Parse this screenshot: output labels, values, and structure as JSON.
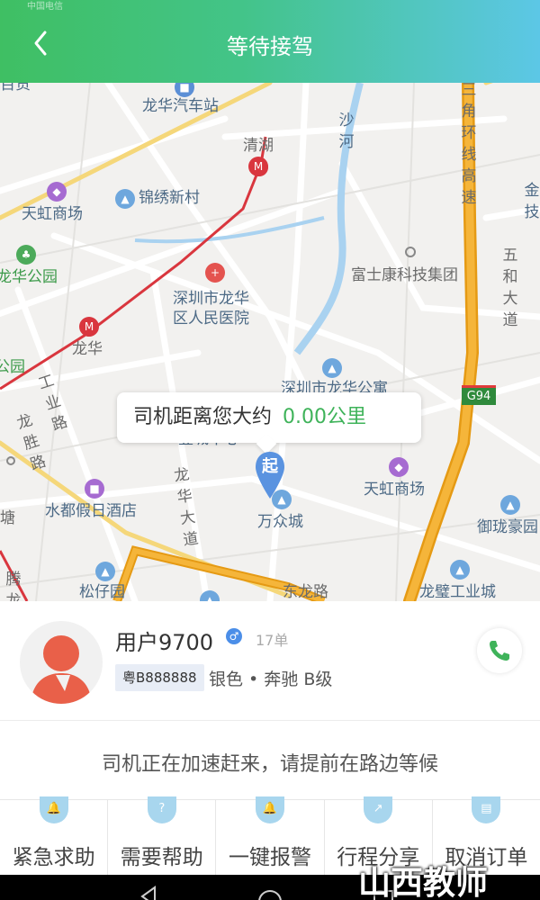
{
  "header": {
    "status_text": "中国电信",
    "title": "等待接驾"
  },
  "map": {
    "pois": {
      "baihuo": "百货",
      "longhua_bus": "龙华汽车站",
      "qinghu": "清湖",
      "jinxiu": "锦绣新村",
      "tianhong_1": "天虹商场",
      "longhua_park": "龙华公园",
      "hospital_1": "深圳市龙华",
      "hospital_2": "区人民医院",
      "longhua": "龙华",
      "gongyuan": "公园",
      "gongye_road": "工业路",
      "longsheng_road": "龙胜路",
      "foxconn": "富士康科技集团",
      "shahe": "沙河",
      "sanjiao_highway": "三角环线高速",
      "wuhe_road": "五和大道",
      "jinji": "金技",
      "apartment": "深圳市龙华公寓",
      "dengcheng": "壹城中心",
      "tianhong_2": "天虹商场",
      "shuidu": "水都假日酒店",
      "longhua_avenue": "龙华大道",
      "wanzhong": "万众城",
      "yulong": "御珑豪园",
      "tang": "塘",
      "tengbu": "腾龙",
      "songzai": "松仔园",
      "dongbu_road": "东龙路",
      "longbi": "龙璧工业城",
      "g94": "G94"
    },
    "bubble_label": "司机距离您大约",
    "bubble_value": "0.00公里",
    "pin_label": "起"
  },
  "driver": {
    "name": "用户9700",
    "gender_symbol": "♂",
    "orders": "17单",
    "plate": "粤B888888",
    "car": "银色 • 奔驰 B级"
  },
  "notice": "司机正在加速赶来，请提前在路边等候",
  "actions": [
    {
      "label": "紧急求助",
      "icon": "bell-icon",
      "glyph": "🔔"
    },
    {
      "label": "需要帮助",
      "icon": "question-icon",
      "glyph": "?"
    },
    {
      "label": "一键报警",
      "icon": "alarm-icon",
      "glyph": "🔔"
    },
    {
      "label": "行程分享",
      "icon": "share-icon",
      "glyph": "↗"
    },
    {
      "label": "取消订单",
      "icon": "cancel-order-icon",
      "glyph": "▤"
    }
  ],
  "watermark": "山西教师",
  "colors": {
    "header_gradient_start": "#3fbf63",
    "header_gradient_end": "#5cc7e6",
    "accent_green": "#3fb35a",
    "highway_orange": "#f2a522",
    "metro_red": "#d9363e"
  }
}
